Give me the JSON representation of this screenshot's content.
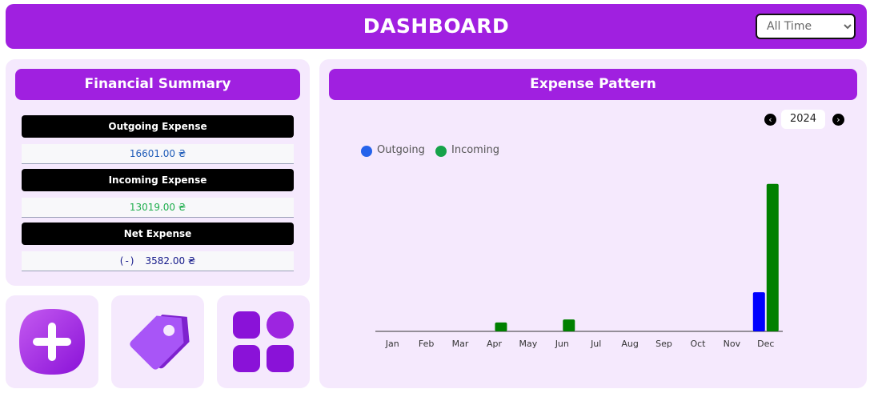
{
  "header": {
    "title": "DASHBOARD",
    "range_select": {
      "selected": "All Time",
      "options": [
        "All Time"
      ]
    }
  },
  "summary": {
    "title": "Financial Summary",
    "outgoing_label": "Outgoing Expense",
    "outgoing_value": "16601.00 ₴",
    "incoming_label": "Incoming Expense",
    "incoming_value": "13019.00 ₴",
    "net_label": "Net Expense",
    "net_sign": "(-)",
    "net_value": "3582.00 ₴"
  },
  "tiles": [
    {
      "icon": "add-icon"
    },
    {
      "icon": "tag-icon"
    },
    {
      "icon": "apps-grid-icon"
    }
  ],
  "chart_panel": {
    "title": "Expense Pattern",
    "year": "2024",
    "prev_icon": "chevron-left-icon",
    "next_icon": "chevron-right-icon"
  },
  "colors": {
    "accent": "#a020e0",
    "panel_bg": "#f5e9fd",
    "outgoing": "#0000ff",
    "incoming": "#008000",
    "legend_outgoing": "#2563eb",
    "legend_incoming": "#16a34a"
  },
  "chart_data": {
    "type": "bar",
    "categories": [
      "Jan",
      "Feb",
      "Mar",
      "Apr",
      "May",
      "Jun",
      "Jul",
      "Aug",
      "Sep",
      "Oct",
      "Nov",
      "Dec"
    ],
    "series": [
      {
        "name": "Outgoing",
        "values": [
          0,
          0,
          0,
          0,
          0,
          0,
          0,
          0,
          0,
          0,
          0,
          3950
        ]
      },
      {
        "name": "Incoming",
        "values": [
          0,
          0,
          0,
          900,
          0,
          1200,
          0,
          0,
          0,
          0,
          0,
          14900
        ]
      }
    ],
    "ylim": [
      0,
      16500
    ],
    "grid": false,
    "legend": "top-left"
  }
}
